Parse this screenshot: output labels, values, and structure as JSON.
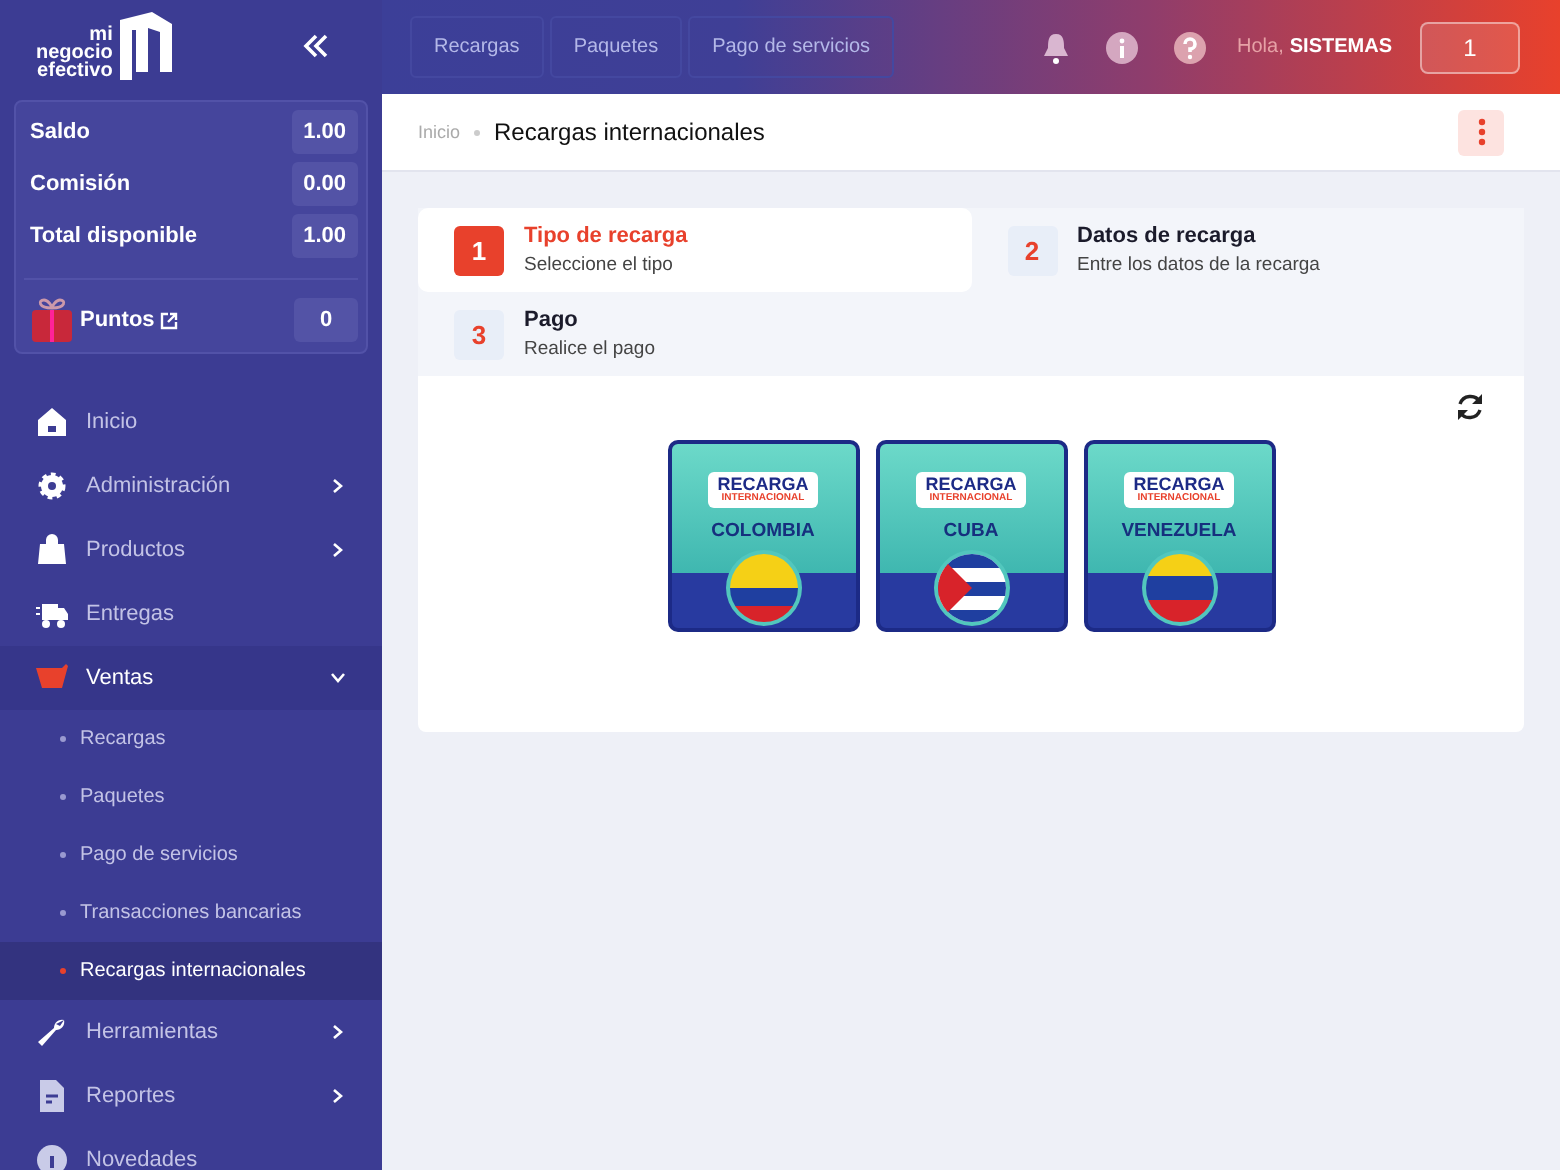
{
  "logo": {
    "lines": [
      "mi",
      "negocio",
      "efectivo"
    ]
  },
  "balance": {
    "rows": [
      {
        "label": "Saldo",
        "value": "1.00"
      },
      {
        "label": "Comisión",
        "value": "0.00"
      },
      {
        "label": "Total disponible",
        "value": "1.00"
      }
    ],
    "points": {
      "label": "Puntos",
      "value": "0"
    }
  },
  "menu": [
    {
      "label": "Inicio",
      "submenu": false,
      "expanded": false
    },
    {
      "label": "Administración",
      "submenu": true,
      "expanded": false
    },
    {
      "label": "Productos",
      "submenu": true,
      "expanded": false
    },
    {
      "label": "Entregas",
      "submenu": false,
      "expanded": false
    },
    {
      "label": "Ventas",
      "submenu": true,
      "expanded": true,
      "children": [
        {
          "label": "Recargas",
          "selected": false
        },
        {
          "label": "Paquetes",
          "selected": false
        },
        {
          "label": "Pago de servicios",
          "selected": false
        },
        {
          "label": "Transacciones bancarias",
          "selected": false
        },
        {
          "label": "Recargas internacionales",
          "selected": true
        }
      ]
    },
    {
      "label": "Herramientas",
      "submenu": true,
      "expanded": false
    },
    {
      "label": "Reportes",
      "submenu": true,
      "expanded": false
    },
    {
      "label": "Novedades",
      "submenu": false,
      "expanded": false
    }
  ],
  "topnav": [
    "Recargas",
    "Paquetes",
    "Pago de servicios"
  ],
  "user": {
    "greeting": "Hola,",
    "name": "SISTEMAS",
    "counter": "1"
  },
  "breadcrumb": {
    "parent": "Inicio",
    "current": "Recargas internacionales"
  },
  "steps": [
    {
      "number": "1",
      "title": "Tipo de recarga",
      "subtitle": "Seleccione el tipo",
      "selected": true
    },
    {
      "number": "2",
      "title": "Datos de recarga",
      "subtitle": "Entre los datos de la recarga",
      "selected": false
    },
    {
      "number": "3",
      "title": "Pago",
      "subtitle": "Realice el pago",
      "selected": false
    }
  ],
  "cards": [
    {
      "banner": "RECARGA",
      "sub": "INTERNACIONAL",
      "country": "COLOMBIA"
    },
    {
      "banner": "RECARGA",
      "sub": "INTERNACIONAL",
      "country": "CUBA"
    },
    {
      "banner": "RECARGA",
      "sub": "INTERNACIONAL",
      "country": "VENEZUELA"
    }
  ]
}
